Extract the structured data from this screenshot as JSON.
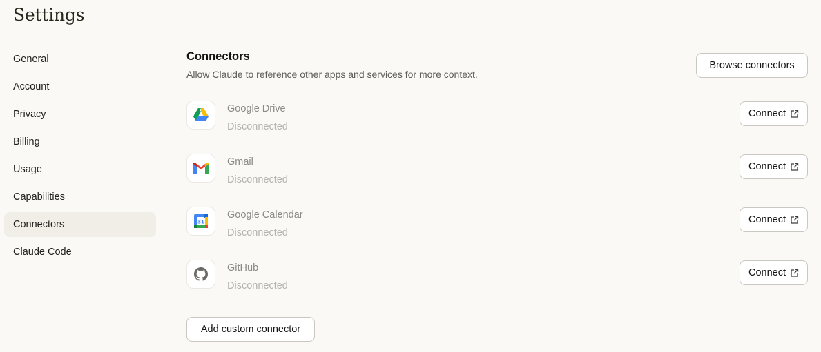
{
  "page": {
    "title": "Settings"
  },
  "sidebar": {
    "items": [
      {
        "label": "General",
        "active": false
      },
      {
        "label": "Account",
        "active": false
      },
      {
        "label": "Privacy",
        "active": false
      },
      {
        "label": "Billing",
        "active": false
      },
      {
        "label": "Usage",
        "active": false
      },
      {
        "label": "Capabilities",
        "active": false
      },
      {
        "label": "Connectors",
        "active": true
      },
      {
        "label": "Claude Code",
        "active": false
      }
    ]
  },
  "connectors": {
    "title": "Connectors",
    "subtitle": "Allow Claude to reference other apps and services for more context.",
    "browse_label": "Browse connectors",
    "add_custom_label": "Add custom connector",
    "items": [
      {
        "name": "Google Drive",
        "status": "Disconnected",
        "icon": "google-drive-icon",
        "action_label": "Connect"
      },
      {
        "name": "Gmail",
        "status": "Disconnected",
        "icon": "gmail-icon",
        "action_label": "Connect"
      },
      {
        "name": "Google Calendar",
        "status": "Disconnected",
        "icon": "google-calendar-icon",
        "action_label": "Connect"
      },
      {
        "name": "GitHub",
        "status": "Disconnected",
        "icon": "github-icon",
        "action_label": "Connect"
      }
    ]
  },
  "colors": {
    "background": "#faf9f5",
    "sidebar_active": "#f0eee6",
    "button_border": "#c9c7bf",
    "muted_text": "#8b8a85",
    "status_text": "#b5b3ad"
  }
}
